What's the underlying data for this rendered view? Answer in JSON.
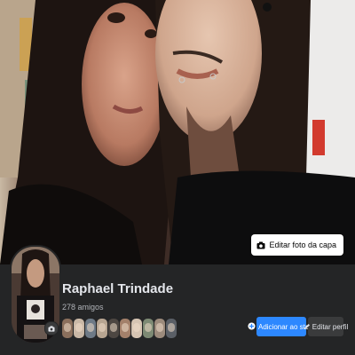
{
  "profile": {
    "name": "Raphael Trindade",
    "friends_count": "278 amigos"
  },
  "cover": {
    "edit_button_label": "Editar foto da capa",
    "edit_button_icon": "camera-icon"
  },
  "actions": {
    "add_story_label": "Adicionar ao story",
    "add_story_icon": "plus-circle-icon",
    "edit_profile_label": "Editar perfil",
    "edit_profile_icon": "pencil-icon"
  },
  "friend_avatar_colors": [
    "#8a6f5c",
    "#c9b8a6",
    "#6e7a86",
    "#b7a591",
    "#4d4742",
    "#a3806a",
    "#d6c5b3",
    "#7d8a74",
    "#9c8b7c",
    "#5a5f66"
  ],
  "colors": {
    "background": "#242526",
    "primary_blue": "#2d88ff",
    "secondary_button": "#3a3b3c",
    "text_primary": "#e4e6eb",
    "text_secondary": "#b0b3b8"
  }
}
